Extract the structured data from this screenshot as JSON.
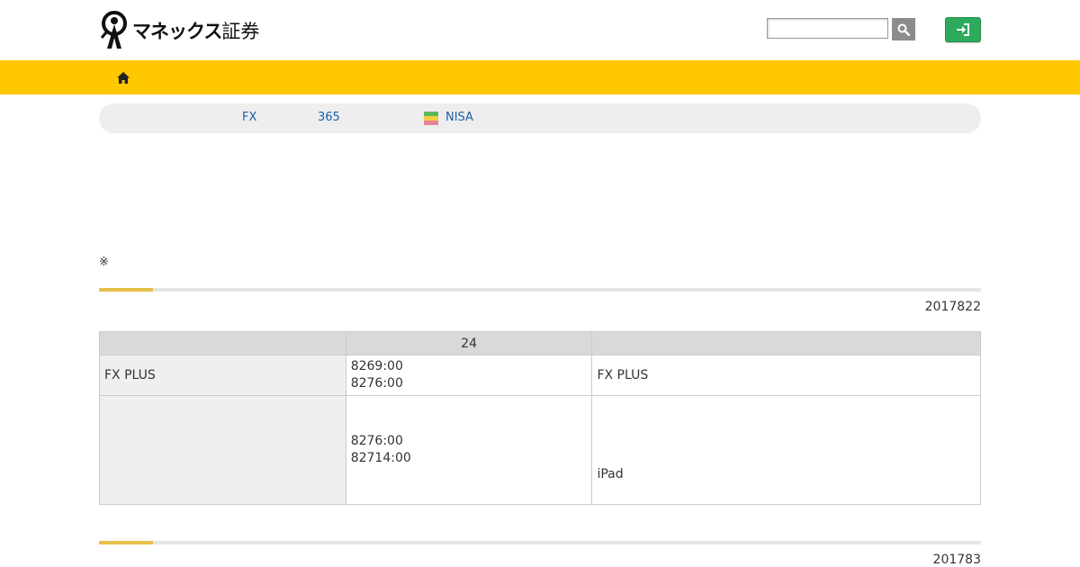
{
  "header": {
    "logo_text": "マネックス",
    "logo_suffix": "証券",
    "search": {
      "placeholder": "",
      "value": ""
    },
    "search_icon": "search-icon",
    "login_icon": "sign-in-icon",
    "colors": {
      "accent_yellow": "#ffc800",
      "login_green": "#2eaa5c",
      "search_gray": "#8c8c8c"
    }
  },
  "nav": {
    "home_icon": "home-icon"
  },
  "subnav": {
    "items": [
      {
        "label": "FX"
      },
      {
        "label": "365"
      },
      {
        "label": "NISA",
        "icon": "nisa-flag-icon"
      }
    ]
  },
  "notice": {
    "mark": "※"
  },
  "sections": [
    {
      "date": "2017822"
    },
    {
      "date": "201783"
    }
  ],
  "table": {
    "headers": [
      "",
      "24",
      ""
    ],
    "rows": [
      {
        "name": "FX PLUS",
        "times": [
          "8269:00",
          "8276:00"
        ],
        "detail": "FX PLUS"
      },
      {
        "name": "",
        "times": [
          "8276:00",
          "82714:00"
        ],
        "detail": "iPad"
      }
    ]
  }
}
